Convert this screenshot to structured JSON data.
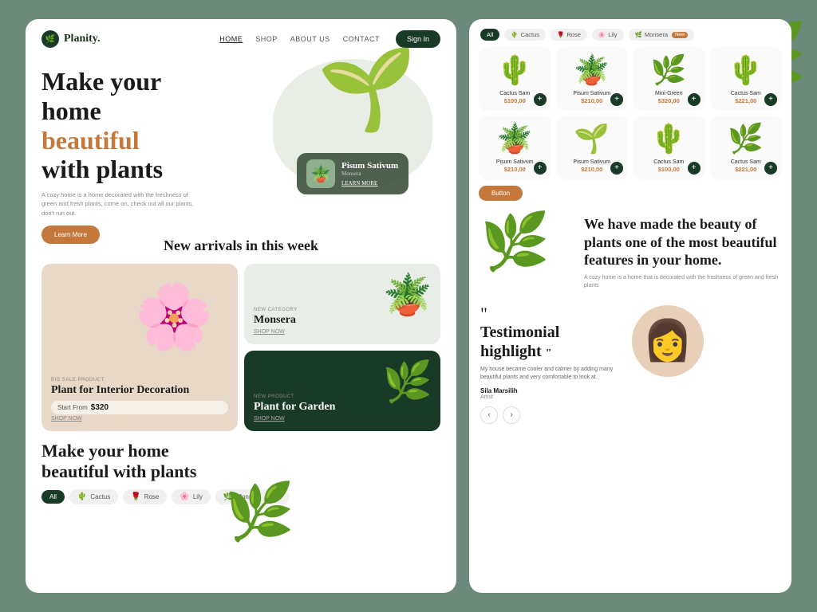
{
  "brand": {
    "name": "Planity.",
    "logo_symbol": "🌿"
  },
  "nav": {
    "links": [
      "HOME",
      "SHOP",
      "ABOUT US",
      "CONTACT"
    ],
    "active": "HOME",
    "signin_label": "Sign In"
  },
  "hero": {
    "title_line1": "Make your",
    "title_line2": "home",
    "title_highlight": "beautiful",
    "title_line3": "with plants",
    "description": "A cozy home is a home decorated with the freshness of green and fresh plants, come on, check out all our plants, don't run out.",
    "cta_label": "Learn More",
    "featured_plant": {
      "name": "Pisum Sativum",
      "category": "Monsera",
      "learn_more": "LEARN MORE"
    }
  },
  "new_arrivals": {
    "section_title": "New arrivals in this week",
    "cards": [
      {
        "badge": "Big Sale Product",
        "name": "Plant for Interior Decoration",
        "price_label": "Start From",
        "price": "$320",
        "cta": "SHOP NOW",
        "bg": "peach"
      },
      {
        "badge": "New Category",
        "name": "Monsera",
        "cta": "SHOP NOW",
        "bg": "light-green"
      },
      {
        "badge": "New Product",
        "name": "Plant for Garden",
        "cta": "SHOP NOW",
        "bg": "dark-green"
      }
    ]
  },
  "bottom_section": {
    "title_line1": "Make your home",
    "title_line2": "beautiful with plants",
    "filter_tabs": [
      {
        "label": "All",
        "active": true
      },
      {
        "label": "Cactus",
        "icon": "🌵"
      },
      {
        "label": "Rose",
        "icon": "🌹"
      },
      {
        "label": "Lily",
        "icon": "🌸"
      },
      {
        "label": "Monsera",
        "icon": "🌿",
        "is_new": true
      }
    ]
  },
  "right_panel": {
    "filter_tabs": [
      {
        "label": "All",
        "active": true
      },
      {
        "label": "Cactus",
        "icon": "🌵"
      },
      {
        "label": "Rose",
        "icon": "🌹"
      },
      {
        "label": "Lily",
        "icon": "🌸"
      },
      {
        "label": "Monsera",
        "icon": "🌿",
        "is_new": true
      }
    ],
    "products": [
      {
        "name": "Cactus Sam",
        "price": "$100,00",
        "emoji": "🌵"
      },
      {
        "name": "Pisum Sativum",
        "price": "$210,00",
        "emoji": "🪴"
      },
      {
        "name": "Mini-Green",
        "price": "$320,00",
        "emoji": "🌿"
      },
      {
        "name": "Cactus Sam",
        "price": "$221,00",
        "emoji": "🌵"
      },
      {
        "name": "Pisum Sativum",
        "price": "$210,00",
        "emoji": "🪴"
      },
      {
        "name": "Pisum Sativum",
        "price": "$210,00",
        "emoji": "🌱"
      },
      {
        "name": "Cactus Sam",
        "price": "$100,00",
        "emoji": "🌵"
      },
      {
        "name": "Cactus Sam",
        "price": "$221,00",
        "emoji": "🌿"
      }
    ],
    "promo_button": "Button",
    "beauty": {
      "title": "We have made the beauty of plants one of the most beautiful features in your home.",
      "description": "A cozy home is a home that is decorated with the freshness of green and fresh plants"
    },
    "testimonial": {
      "title_line1": "Testimonial",
      "title_line2": "highlight",
      "quote": "My house became cooler and calmer by adding many beautiful plants and very comfortable to look at.",
      "author": "Sila Marsilih",
      "role": "Artist",
      "nav_prev": "‹",
      "nav_next": "›"
    }
  }
}
